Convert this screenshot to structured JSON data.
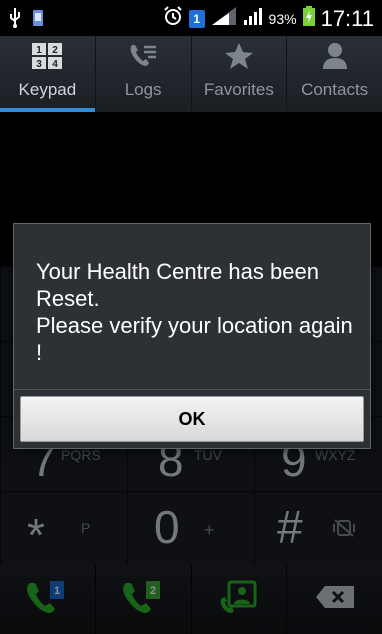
{
  "status_bar": {
    "battery": "93%",
    "time": "17:11",
    "sim_number": "1"
  },
  "tabs": [
    {
      "label": "Keypad",
      "icon": "keypad-icon",
      "active": true
    },
    {
      "label": "Logs",
      "icon": "call-log-icon"
    },
    {
      "label": "Favorites",
      "icon": "star-icon"
    },
    {
      "label": "Contacts",
      "icon": "contact-icon"
    }
  ],
  "keypad": {
    "row3": [
      {
        "digit": "7",
        "letters": "PQRS"
      },
      {
        "digit": "8",
        "letters": "TUV"
      },
      {
        "digit": "9",
        "letters": "WXYZ"
      }
    ],
    "row4": [
      {
        "digit": "*",
        "letters": "P"
      },
      {
        "digit": "0",
        "letters": "+"
      },
      {
        "digit": "#",
        "letters": ""
      }
    ]
  },
  "actions": {
    "sim1_badge": "1",
    "sim2_badge": "2"
  },
  "dialog": {
    "message": "Your Health Centre has been Reset.\nPlease verify your location again !",
    "ok_label": "OK"
  },
  "colors": {
    "tab_accent": "#2f8dd9",
    "sim1": "#1e6ed8",
    "sim2": "#3fae3a",
    "call_green": "#2fb52f"
  }
}
